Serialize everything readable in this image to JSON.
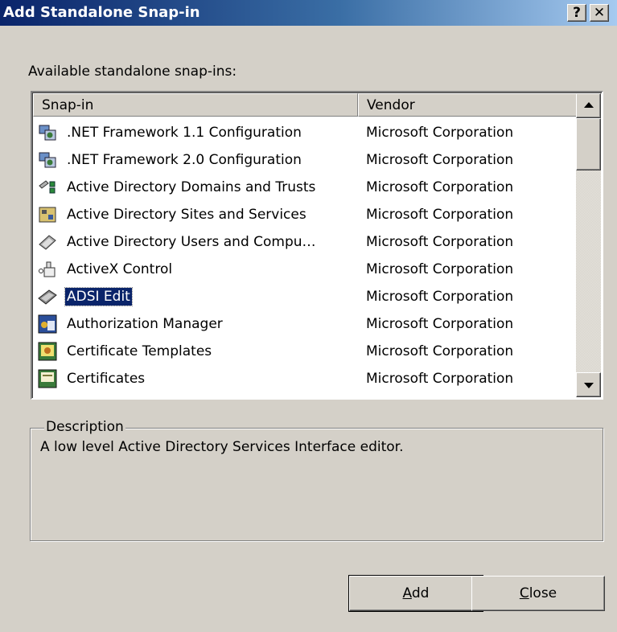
{
  "window": {
    "title": "Add Standalone Snap-in",
    "help_label": "?",
    "close_label": "✕"
  },
  "available_label": "Available standalone snap-ins:",
  "list": {
    "columns": [
      "Snap-in",
      "Vendor"
    ],
    "rows": [
      {
        "name": ".NET Framework 1.1 Configuration",
        "vendor": "Microsoft Corporation",
        "icon": "net-config-icon",
        "selected": false
      },
      {
        "name": ".NET Framework 2.0 Configuration",
        "vendor": "Microsoft Corporation",
        "icon": "net-config-icon",
        "selected": false
      },
      {
        "name": "Active Directory Domains and Trusts",
        "vendor": "Microsoft Corporation",
        "icon": "domains-trusts-icon",
        "selected": false
      },
      {
        "name": "Active Directory Sites and Services",
        "vendor": "Microsoft Corporation",
        "icon": "sites-services-icon",
        "selected": false
      },
      {
        "name": "Active Directory Users and Compu…",
        "vendor": "Microsoft Corporation",
        "icon": "users-computers-icon",
        "selected": false
      },
      {
        "name": "ActiveX Control",
        "vendor": "Microsoft Corporation",
        "icon": "activex-icon",
        "selected": false
      },
      {
        "name": "ADSI Edit",
        "vendor": "Microsoft Corporation",
        "icon": "adsi-edit-icon",
        "selected": true
      },
      {
        "name": "Authorization Manager",
        "vendor": "Microsoft Corporation",
        "icon": "authorization-manager-icon",
        "selected": false
      },
      {
        "name": "Certificate Templates",
        "vendor": "Microsoft Corporation",
        "icon": "certificate-templates-icon",
        "selected": false
      },
      {
        "name": "Certificates",
        "vendor": "Microsoft Corporation",
        "icon": "certificates-icon",
        "selected": false
      }
    ]
  },
  "description": {
    "legend": "Description",
    "text": "A low level Active Directory Services Interface editor."
  },
  "buttons": {
    "add": {
      "mnemonic": "A",
      "rest": "dd"
    },
    "close": {
      "mnemonic": "C",
      "rest": "lose"
    }
  },
  "colors": {
    "title_start": "#0a246a",
    "title_end": "#a6caf0",
    "selection": "#0a246a",
    "face": "#d4d0c8"
  }
}
